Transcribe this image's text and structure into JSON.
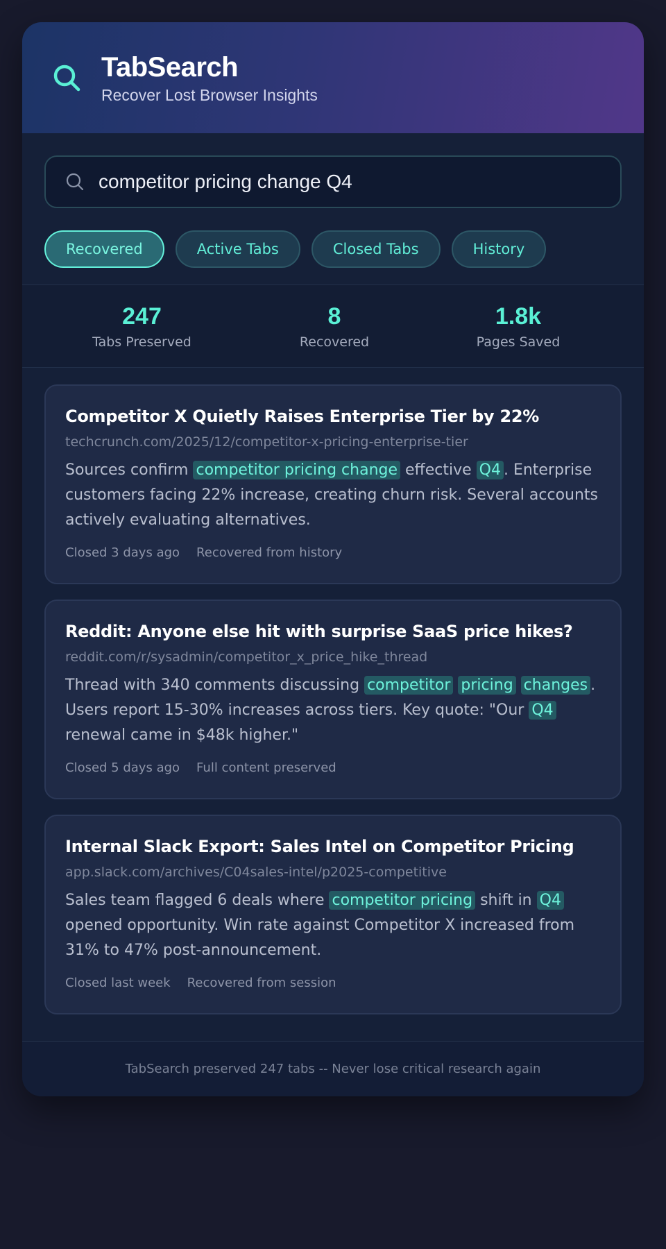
{
  "app": {
    "title": "TabSearch",
    "subtitle": "Recover Lost Browser Insights",
    "logo_icon": "search-icon",
    "accent_color": "#5af0d5"
  },
  "search": {
    "value": "competitor pricing change Q4",
    "placeholder": ""
  },
  "filters": [
    {
      "label": "Recovered",
      "active": true
    },
    {
      "label": "Active Tabs",
      "active": false
    },
    {
      "label": "Closed Tabs",
      "active": false
    },
    {
      "label": "History",
      "active": false
    }
  ],
  "stats": [
    {
      "value": "247",
      "label": "Tabs Preserved"
    },
    {
      "value": "8",
      "label": "Recovered"
    },
    {
      "value": "1.8k",
      "label": "Pages Saved"
    }
  ],
  "results": [
    {
      "title": "Competitor X Quietly Raises Enterprise Tier by 22%",
      "url": "techcrunch.com/2025/12/competitor-x-pricing-enterprise-tier",
      "snippet": [
        {
          "text": "Sources confirm "
        },
        {
          "text": "competitor pricing change",
          "highlight": true
        },
        {
          "text": " effective "
        },
        {
          "text": "Q4",
          "highlight": true
        },
        {
          "text": ". Enterprise customers facing 22% increase, creating churn risk. Several accounts actively evaluating alternatives."
        }
      ],
      "meta": [
        "Closed 3 days ago",
        "Recovered from history"
      ]
    },
    {
      "title": "Reddit: Anyone else hit with surprise SaaS price hikes?",
      "url": "reddit.com/r/sysadmin/competitor_x_price_hike_thread",
      "snippet": [
        {
          "text": "Thread with 340 comments discussing "
        },
        {
          "text": "competitor",
          "highlight": true
        },
        {
          "text": " "
        },
        {
          "text": "pricing",
          "highlight": true
        },
        {
          "text": " "
        },
        {
          "text": "changes",
          "highlight": true
        },
        {
          "text": ". Users report 15-30% increases across tiers. Key quote: \"Our "
        },
        {
          "text": "Q4",
          "highlight": true
        },
        {
          "text": " renewal came in $48k higher.\""
        }
      ],
      "meta": [
        "Closed 5 days ago",
        "Full content preserved"
      ]
    },
    {
      "title": "Internal Slack Export: Sales Intel on Competitor Pricing",
      "url": "app.slack.com/archives/C04sales-intel/p2025-competitive",
      "snippet": [
        {
          "text": "Sales team flagged 6 deals where "
        },
        {
          "text": "competitor pricing",
          "highlight": true
        },
        {
          "text": " shift in "
        },
        {
          "text": "Q4",
          "highlight": true
        },
        {
          "text": " opened opportunity. Win rate against Competitor X increased from 31% to 47% post-announcement."
        }
      ],
      "meta": [
        "Closed last week",
        "Recovered from session"
      ]
    }
  ],
  "footer": {
    "text": "TabSearch preserved 247 tabs -- Never lose critical research again"
  }
}
